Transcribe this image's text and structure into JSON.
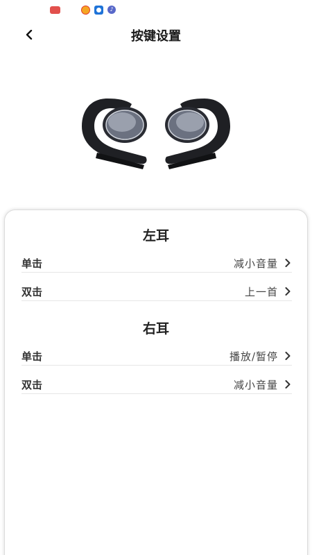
{
  "header": {
    "title": "按键设置"
  },
  "left_ear": {
    "title": "左耳",
    "rows": [
      {
        "label": "单击",
        "value": "减小音量"
      },
      {
        "label": "双击",
        "value": "上一首"
      }
    ]
  },
  "right_ear": {
    "title": "右耳",
    "rows": [
      {
        "label": "单击",
        "value": "播放/暂停"
      },
      {
        "label": "双击",
        "value": "减小音量"
      }
    ]
  },
  "icons": {
    "back": "chevron-left-icon",
    "row_arrow": "chevron-right-icon"
  },
  "colors": {
    "background": "#ffffff",
    "text": "#222222",
    "divider": "#e6e6e6"
  }
}
